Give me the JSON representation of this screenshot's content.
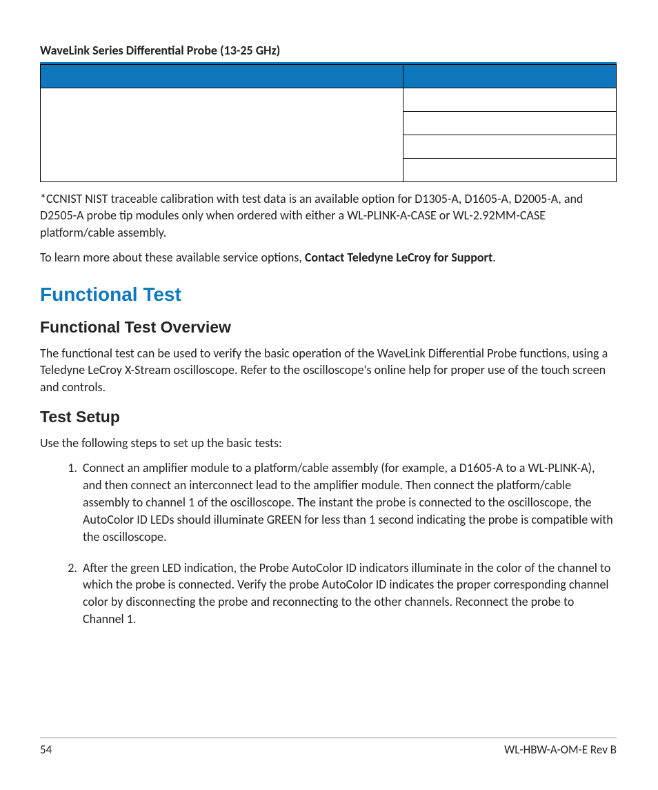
{
  "header": {
    "title": "WaveLink Series Differential Probe (13-25 GHz)"
  },
  "footnote": "*CCNIST NIST traceable calibration with test data is an available option for D1305-A, D1605-A, D2005-A, and D2505-A probe tip modules only when ordered with either a WL-PLINK-A-CASE or WL-2.92MM-CASE platform/cable assembly.",
  "learn_more_prefix": "To learn more about these available service options, ",
  "learn_more_bold": "Contact Teledyne LeCroy for Support",
  "learn_more_suffix": ".",
  "section_title": "Functional Test",
  "overview": {
    "heading": "Functional Test Overview",
    "body": "The functional test can be used to verify the basic operation of the WaveLink Differential Probe functions, using a Teledyne LeCroy X-Stream oscilloscope. Refer to the oscilloscope's online help for proper use of the touch screen and controls."
  },
  "setup": {
    "heading": "Test Setup",
    "intro": "Use the following steps to set up the basic tests:",
    "steps": [
      "Connect an amplifier module to a platform/cable assembly (for example, a D1605-A to a WL-PLINK-A), and then connect an interconnect lead to the amplifier module. Then connect the platform/cable assembly to channel 1 of the oscilloscope. The instant the probe is connected to the oscilloscope, the AutoColor ID LEDs should illuminate GREEN for less than 1 second indicating the probe is compatible with the oscilloscope.",
      "After the green LED indication, the Probe AutoColor ID indicators illuminate in the color of the channel to which the probe is connected. Verify the probe AutoColor ID indicates the proper corresponding channel color by disconnecting the probe and reconnecting to the other channels. Reconnect the probe to Channel 1."
    ]
  },
  "footer": {
    "page_number": "54",
    "doc_id": "WL-HBW-A-OM-E Rev B"
  }
}
